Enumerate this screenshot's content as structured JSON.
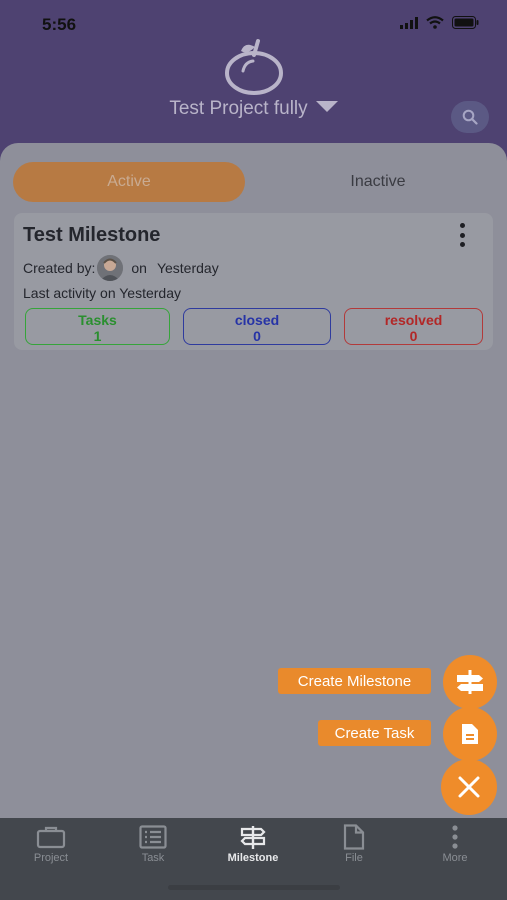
{
  "status_bar": {
    "time": "5:56"
  },
  "header": {
    "project_title": "Test Project fully"
  },
  "tabs": {
    "active_label": "Active",
    "inactive_label": "Inactive"
  },
  "milestone": {
    "title": "Test Milestone",
    "created_by_label": "Created by:",
    "on_label": "on",
    "created_when": "Yesterday",
    "last_activity": "Last activity on Yesterday",
    "stats": {
      "tasks_label": "Tasks",
      "tasks_count": "1",
      "closed_label": "closed",
      "closed_count": "0",
      "resolved_label": "resolved",
      "resolved_count": "0"
    }
  },
  "fab_menu": {
    "create_milestone_label": "Create Milestone",
    "create_task_label": "Create Task"
  },
  "bottom_nav": {
    "items": [
      {
        "label": "Project",
        "icon": "briefcase-icon"
      },
      {
        "label": "Task",
        "icon": "list-icon"
      },
      {
        "label": "Milestone",
        "icon": "signpost-icon"
      },
      {
        "label": "File",
        "icon": "file-icon"
      },
      {
        "label": "More",
        "icon": "more-vertical-icon"
      }
    ],
    "active": "Milestone"
  },
  "colors": {
    "header": "#4e4271",
    "accent": "#ef8c2a",
    "tasks": "#36a43a",
    "closed": "#2f3b9e",
    "resolved": "#b23a3a"
  }
}
